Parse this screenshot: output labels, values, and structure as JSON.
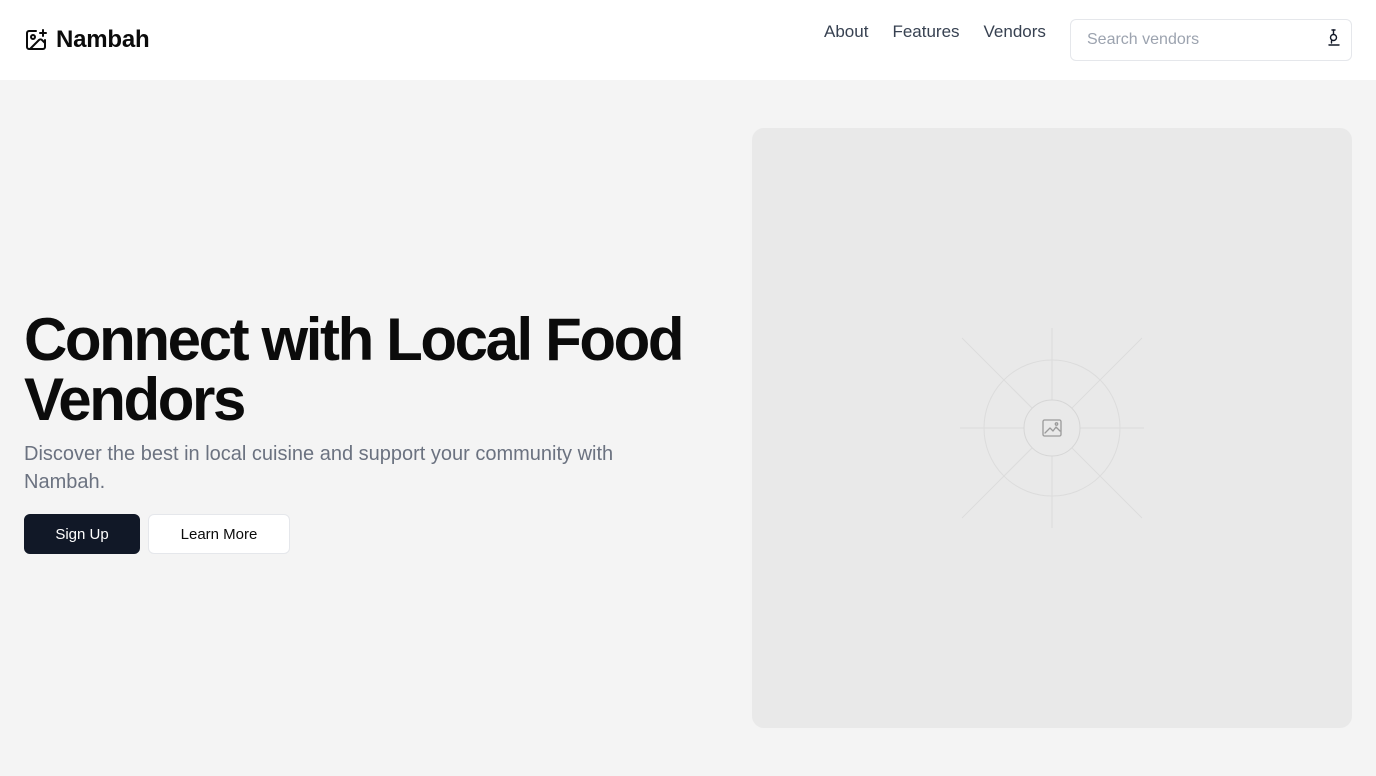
{
  "header": {
    "brand": {
      "name": "Nambah",
      "icon": "image-plus-icon"
    },
    "nav": [
      {
        "label": "About"
      },
      {
        "label": "Features"
      },
      {
        "label": "Vendors"
      }
    ],
    "search": {
      "placeholder": "Search vendors",
      "value": "",
      "icon": "search-icon"
    }
  },
  "hero": {
    "title": "Connect with Local Food Vendors",
    "subtitle": "Discover the best in local cuisine and support your community with Nambah.",
    "primary_button": "Sign Up",
    "secondary_button": "Learn More",
    "image": {
      "icon": "image-placeholder-icon"
    }
  },
  "colors": {
    "page_bg": "#f4f4f4",
    "header_bg": "#ffffff",
    "primary": "#111827",
    "muted_text": "#6b7280",
    "placeholder_bg": "#e9e9e9"
  }
}
